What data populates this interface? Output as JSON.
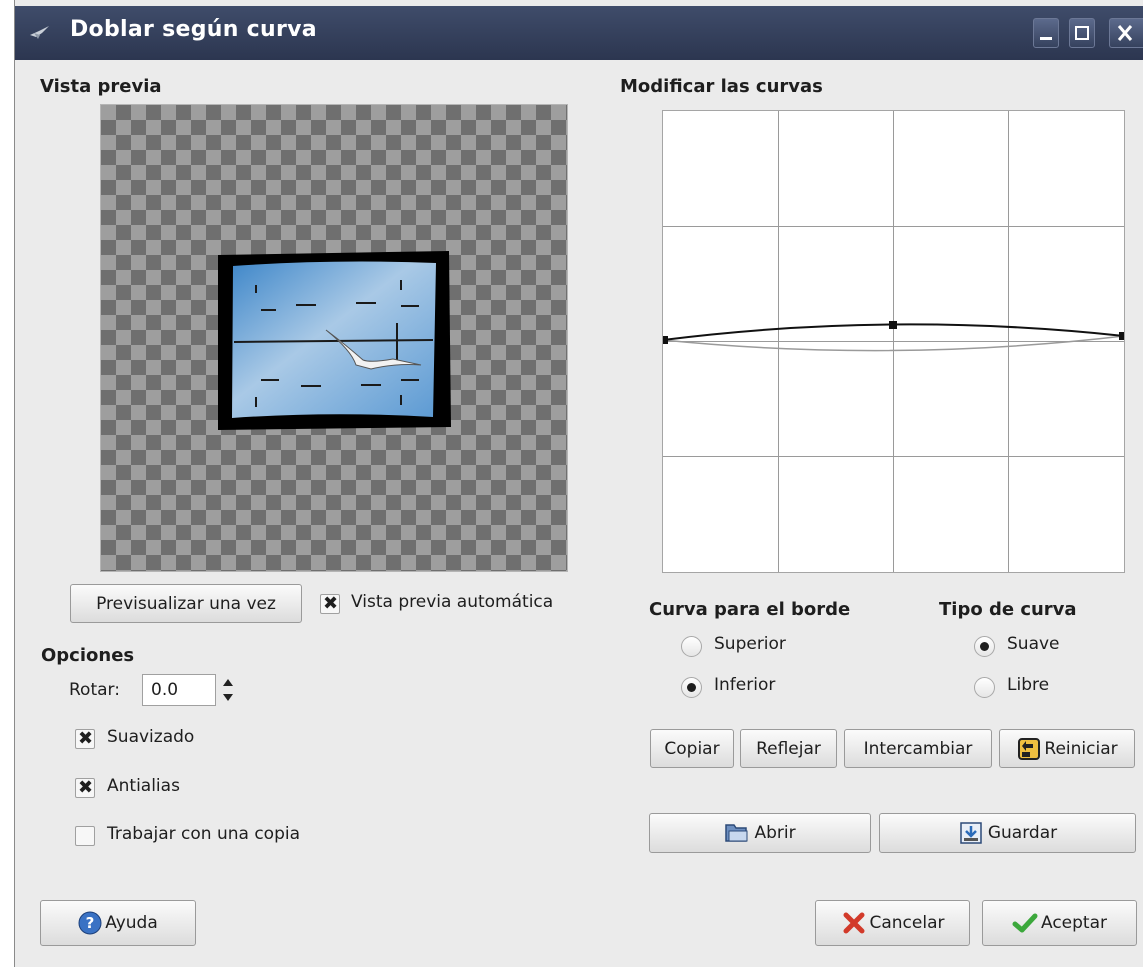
{
  "window": {
    "title": "Doblar según curva"
  },
  "preview": {
    "heading": "Vista previa",
    "preview_once_button": "Previsualizar una vez",
    "auto_preview_label": "Vista previa automática",
    "auto_preview_checked": true
  },
  "options": {
    "heading": "Opciones",
    "rotate_label": "Rotar:",
    "rotate_value": "0.0",
    "smoothing_label": "Suavizado",
    "smoothing_checked": true,
    "antialias_label": "Antialias",
    "antialias_checked": true,
    "work_on_copy_label": "Trabajar con una copia",
    "work_on_copy_checked": false
  },
  "curves": {
    "heading": "Modificar las curvas",
    "border_heading": "Curva para el borde",
    "upper_label": "Superior",
    "lower_label": "Inferior",
    "border_selected": "Inferior",
    "type_heading": "Tipo de curva",
    "smooth_label": "Suave",
    "free_label": "Libre",
    "type_selected": "Suave",
    "copy_button": "Copiar",
    "mirror_button": "Reflejar",
    "swap_button": "Intercambiar",
    "reset_button": "Reiniciar",
    "open_button": "Abrir",
    "save_button": "Guardar"
  },
  "footer": {
    "help_button": "Ayuda",
    "cancel_button": "Cancelar",
    "ok_button": "Aceptar"
  }
}
